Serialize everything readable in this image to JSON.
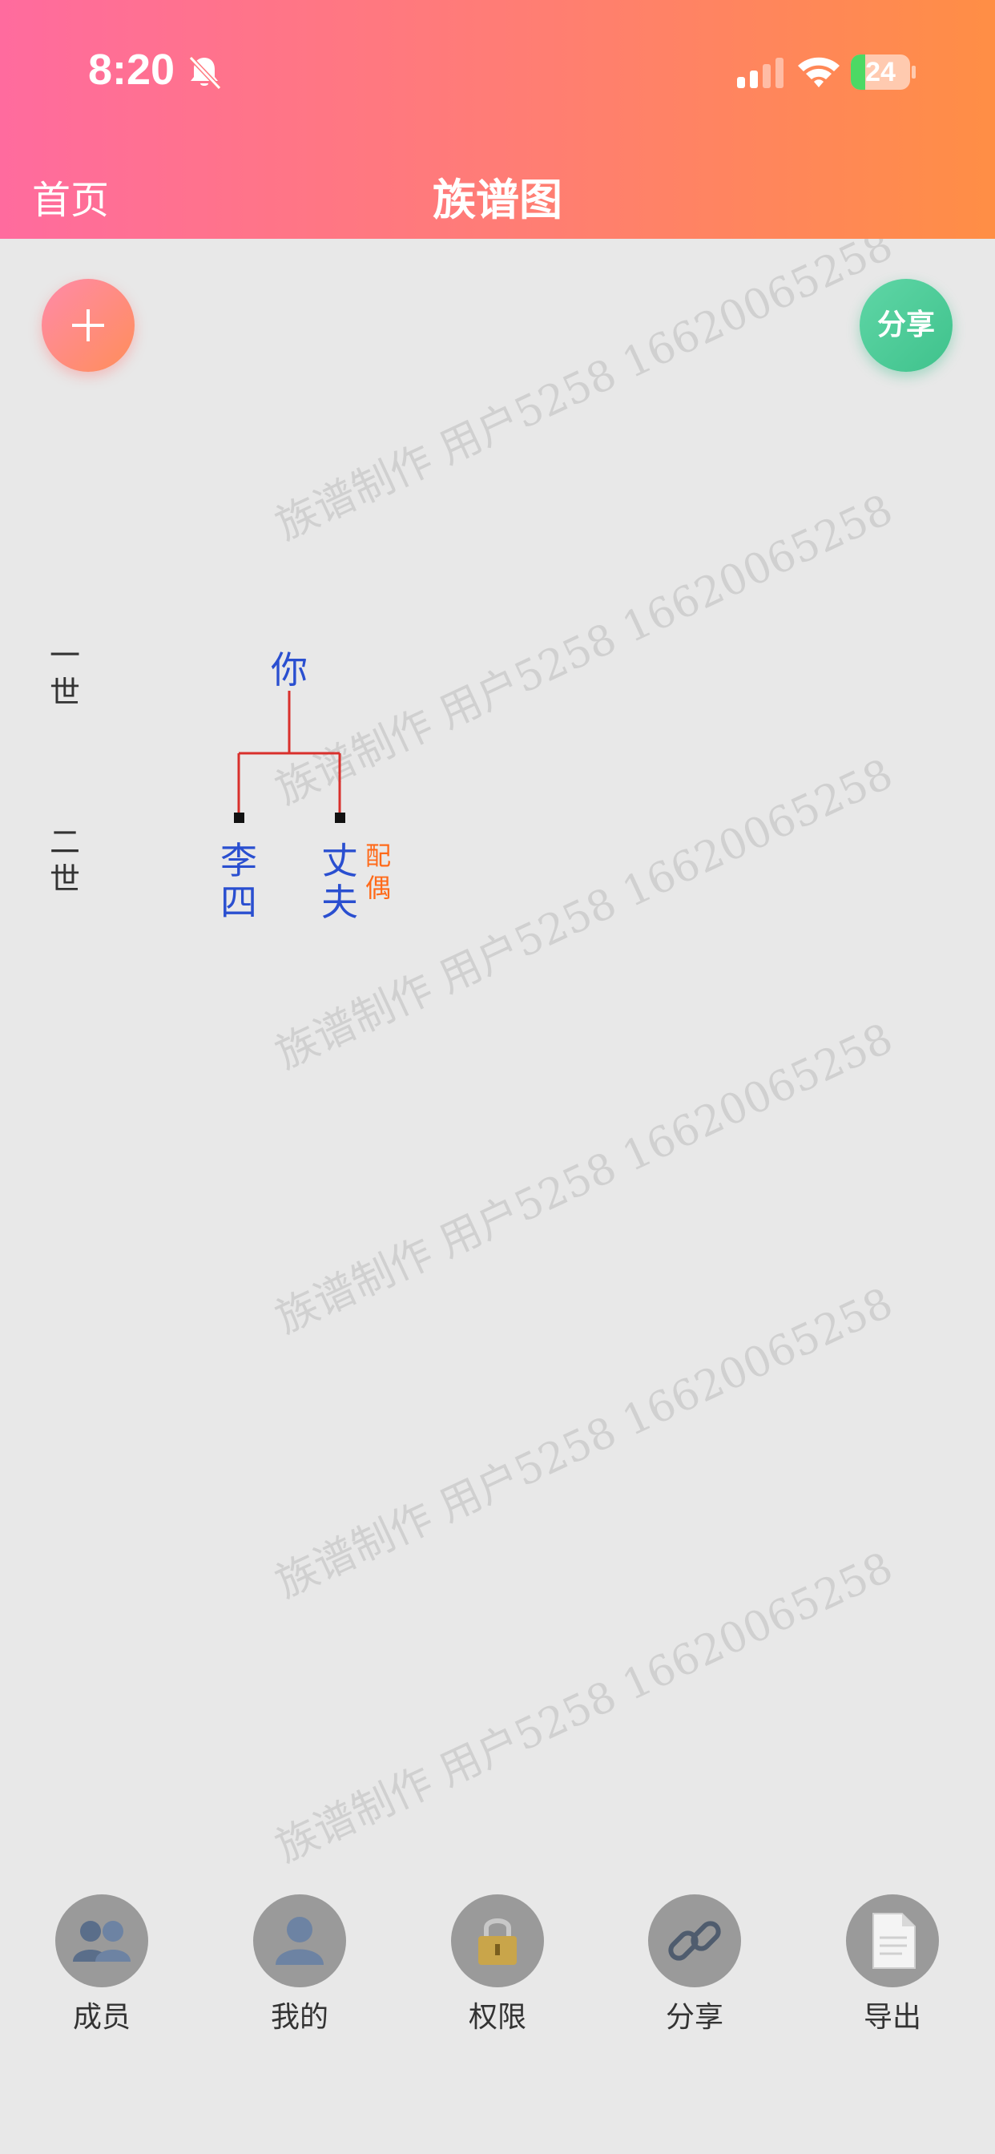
{
  "status_bar": {
    "time": "8:20",
    "battery": "24",
    "battery_level": 0.24
  },
  "header": {
    "back_label": "首页",
    "title": "族谱图"
  },
  "actions": {
    "share_label": "分享"
  },
  "watermark": "族谱制作 用户5258 16620065258",
  "tree": {
    "generations": [
      {
        "label": "一世"
      },
      {
        "label": "二世"
      }
    ],
    "root": {
      "name": "你"
    },
    "children": [
      {
        "name": "李四",
        "spouse": false
      },
      {
        "name": "丈夫",
        "spouse": true,
        "spouse_tag": "配偶"
      }
    ],
    "line_color": "#d9302c",
    "name_color": "#2a4fd0"
  },
  "tabbar": [
    {
      "label": "成员",
      "icon": "members-icon"
    },
    {
      "label": "我的",
      "icon": "user-icon"
    },
    {
      "label": "权限",
      "icon": "lock-icon"
    },
    {
      "label": "分享",
      "icon": "link-icon"
    },
    {
      "label": "导出",
      "icon": "document-icon"
    }
  ]
}
